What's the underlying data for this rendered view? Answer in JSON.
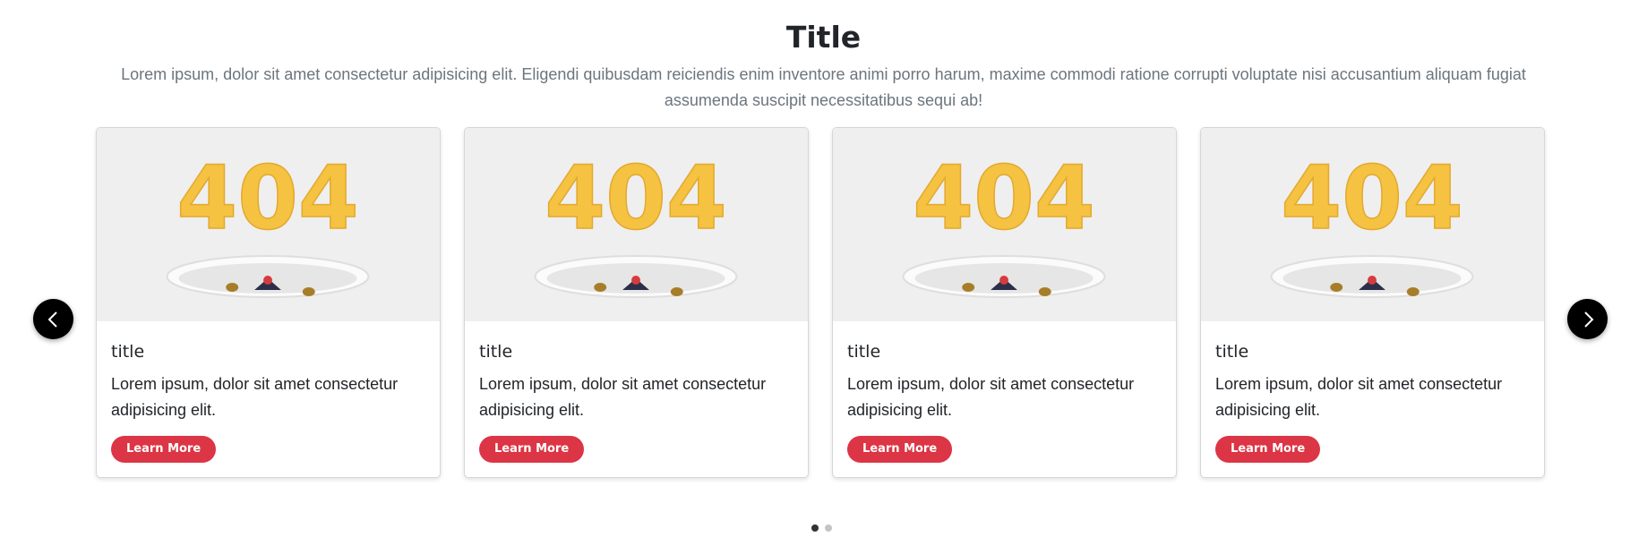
{
  "section": {
    "title": "Title",
    "description": "Lorem ipsum, dolor sit amet consectetur adipisicing elit. Eligendi quibusdam reiciendis enim inventore animi porro harum, maxime commodi ratione corrupti voluptate nisi accusantium aliquam fugiat assumenda suscipit necessitatibus sequi ab!"
  },
  "cards": [
    {
      "image_text": "404",
      "title": "title",
      "text": "Lorem ipsum, dolor sit amet consectetur adipisicing elit.",
      "button_label": "Learn More"
    },
    {
      "image_text": "404",
      "title": "title",
      "text": "Lorem ipsum, dolor sit amet consectetur adipisicing elit.",
      "button_label": "Learn More"
    },
    {
      "image_text": "404",
      "title": "title",
      "text": "Lorem ipsum, dolor sit amet consectetur adipisicing elit.",
      "button_label": "Learn More"
    },
    {
      "image_text": "404",
      "title": "title",
      "text": "Lorem ipsum, dolor sit amet consectetur adipisicing elit.",
      "button_label": "Learn More"
    }
  ],
  "navigation": {
    "prev_icon": "chevron-left-icon",
    "next_icon": "chevron-right-icon"
  },
  "pagination": {
    "pages": 2,
    "active": 1
  },
  "colors": {
    "accent": "#dc3545",
    "nav_button": "#000000",
    "image_digits": "#f5c242"
  }
}
